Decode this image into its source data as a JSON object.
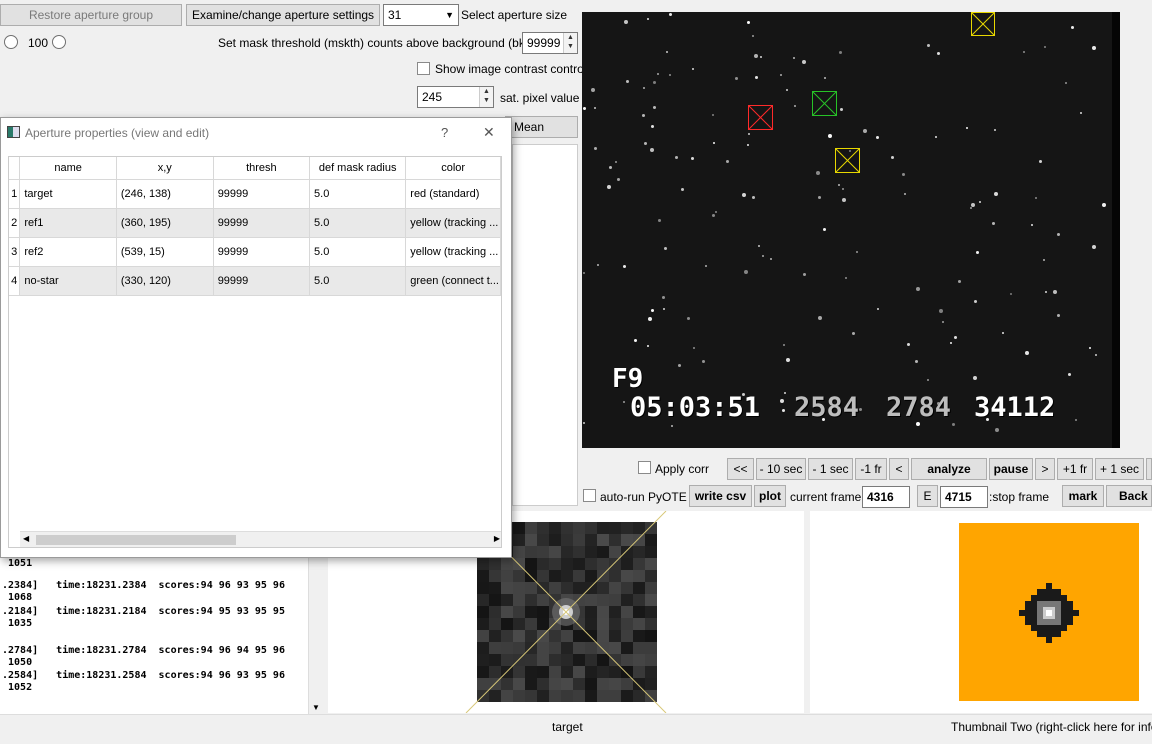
{
  "toolbar": {
    "restore_label": "Restore aperture group",
    "examine_label": "Examine/change aperture settings",
    "aperture_size_value": "31",
    "aperture_size_label": "Select aperture size",
    "radio_value": "100",
    "threshold_label": "Set mask threshold (mskth) counts above background (bkavg)",
    "threshold_value": "99999",
    "contrast_label": "Show image contrast control",
    "sat_value": "245",
    "sat_label": "sat. pixel value",
    "mean_label": "Mean"
  },
  "dialog": {
    "title": "Aperture properties (view and edit)",
    "help": "?",
    "close": "✕",
    "columns": [
      "name",
      "x,y",
      "thresh",
      "def mask radius",
      "color"
    ],
    "rows": [
      {
        "num": "1",
        "name": "target",
        "xy": "(246, 138)",
        "thresh": "99999",
        "radius": "5.0",
        "color": "red (standard)"
      },
      {
        "num": "2",
        "name": "ref1",
        "xy": "(360, 195)",
        "thresh": "99999",
        "radius": "5.0",
        "color": "yellow (tracking ..."
      },
      {
        "num": "3",
        "name": "ref2",
        "xy": "(539, 15)",
        "thresh": "99999",
        "radius": "5.0",
        "color": "yellow (tracking ..."
      },
      {
        "num": "4",
        "name": "no-star",
        "xy": "(330, 120)",
        "thresh": "99999",
        "radius": "5.0",
        "color": "green (connect t..."
      }
    ]
  },
  "image_overlay": {
    "frame_id": "F9",
    "time": "05:03:51",
    "n1": "2584",
    "n2": "2784",
    "n3": "34112"
  },
  "controls": {
    "apply_corr": "Apply corr",
    "back_all": "<<",
    "minus10": "- 10 sec",
    "minus1": "- 1 sec",
    "minus1fr": "-1 fr",
    "back_one": "<",
    "analyze": "analyze",
    "pause": "pause",
    "fwd_one": ">",
    "plus1fr": "+1 fr",
    "plus1sec": "+ 1 sec",
    "auto_run": "auto-run PyOTE",
    "write_csv": "write csv",
    "plot": "plot",
    "current_frame_label": "current frame:",
    "current_frame_value": "4316",
    "e_label": "E",
    "stop_frame_value": "4715",
    "stop_frame_label": ":stop frame",
    "mark": "mark",
    "back": "Back t"
  },
  "log": {
    "lines": [
      " 1051",
      ".2384]   time:18231.2384  scores:94 96 93 95 96",
      " 1068",
      ".2184]   time:18231.2184  scores:94 95 93 95 95",
      " 1035",
      ".2784]   time:18231.2784  scores:94 96 94 95 96",
      " 1050",
      ".2584]   time:18231.2584  scores:94 96 93 95 96",
      " 1052"
    ]
  },
  "thumbnails": {
    "one_label": "target",
    "two_label": "Thumbnail Two (right-click here for info)",
    "two_bg_color": "#ffa500"
  },
  "aperture_colors": {
    "target": "#ff2a2a",
    "ref": "#e8d800",
    "no_star": "#27c227"
  }
}
